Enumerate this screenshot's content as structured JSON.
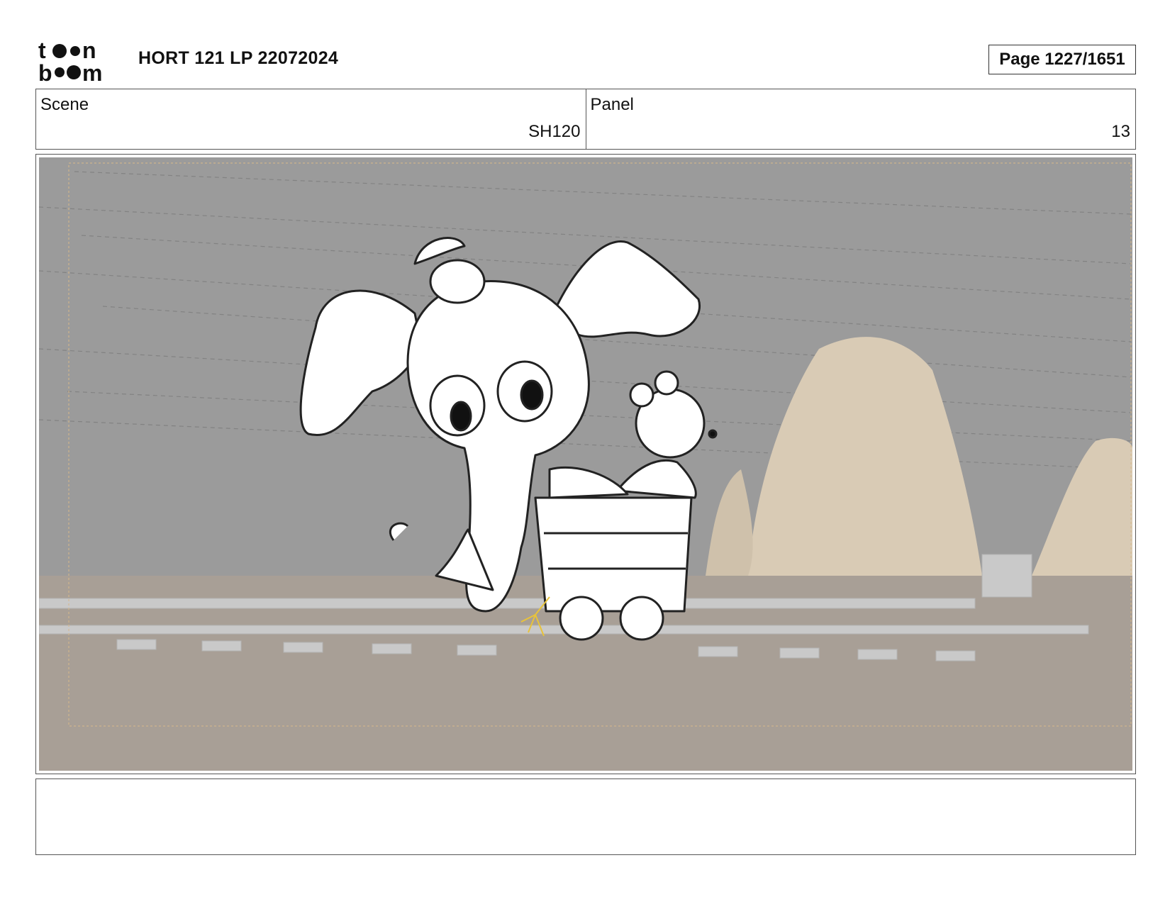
{
  "header": {
    "logo_text": "toon boom",
    "title": "HORT 121 LP 22072024",
    "page_label": "Page 1227/1651"
  },
  "info": {
    "scene_label": "Scene",
    "scene_value": "SH120",
    "panel_label": "Panel",
    "panel_value": "13"
  },
  "panel": {
    "image_description": "storyboard-drawing",
    "colors": {
      "sky": "#9b9b9b",
      "ground": "#a89f96",
      "rock": "#d9cbb5",
      "track": "#c9c9c9"
    }
  },
  "notes": {
    "text": ""
  }
}
